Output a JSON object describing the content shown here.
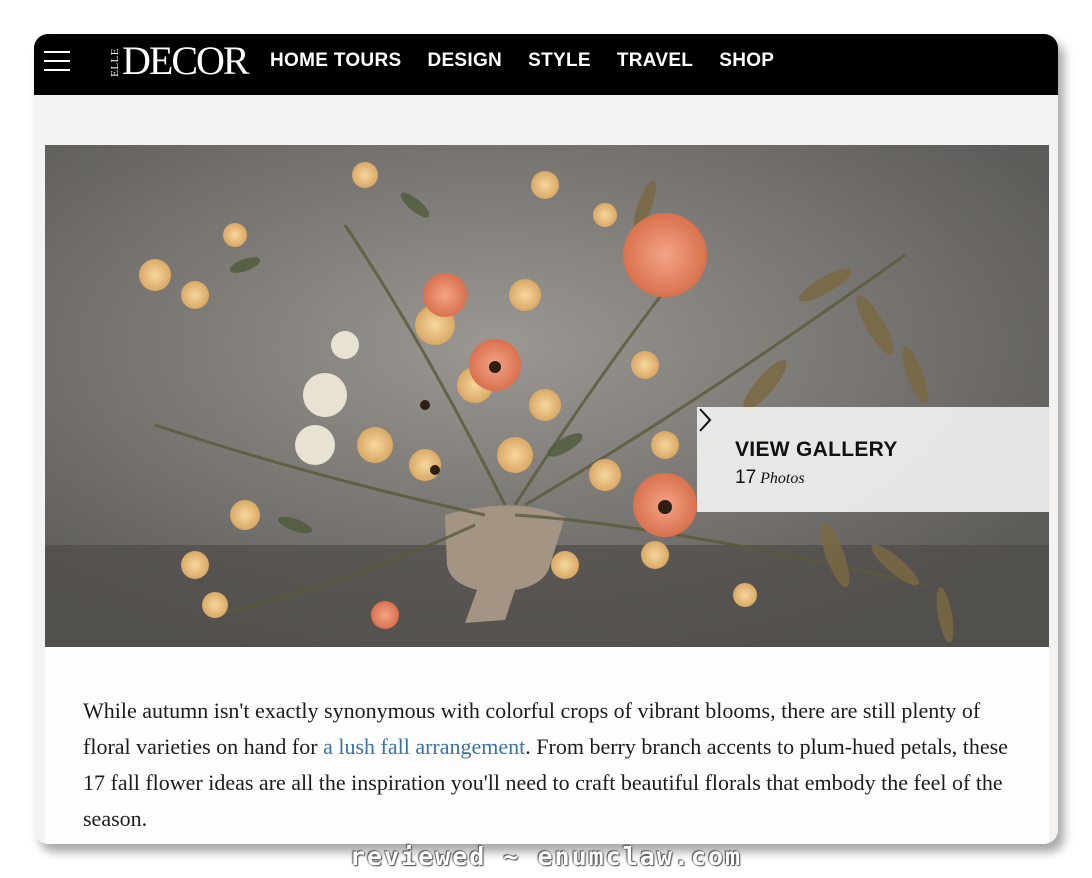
{
  "navbar": {
    "logo_small": "ELLE",
    "logo_main": "DECOR",
    "links": [
      "HOME TOURS",
      "DESIGN",
      "STYLE",
      "TRAVEL",
      "SHOP"
    ],
    "menu_icon": "hamburger-menu-icon"
  },
  "hero": {
    "image_subject": "floral-arrangement-photo",
    "gallery": {
      "title": "VIEW GALLERY",
      "count": "17",
      "count_label": "Photos",
      "arrow_icon": "chevron-right-icon"
    }
  },
  "article": {
    "text_before_link": "While autumn isn't exactly synonymous with colorful crops of vibrant blooms, there are still plenty of floral varieties on hand for ",
    "link_text": "a lush fall arrangement",
    "text_after_link": ". From berry branch accents to plum-hued petals, these 17 fall flower ideas are all the inspiration you'll need to craft beautiful florals that embody the feel of the season."
  },
  "watermark": "reviewed ~ enumclaw.com",
  "colors": {
    "nav_background": "#000000",
    "link": "#3a72a8",
    "page_background": "#f4f3f1"
  }
}
